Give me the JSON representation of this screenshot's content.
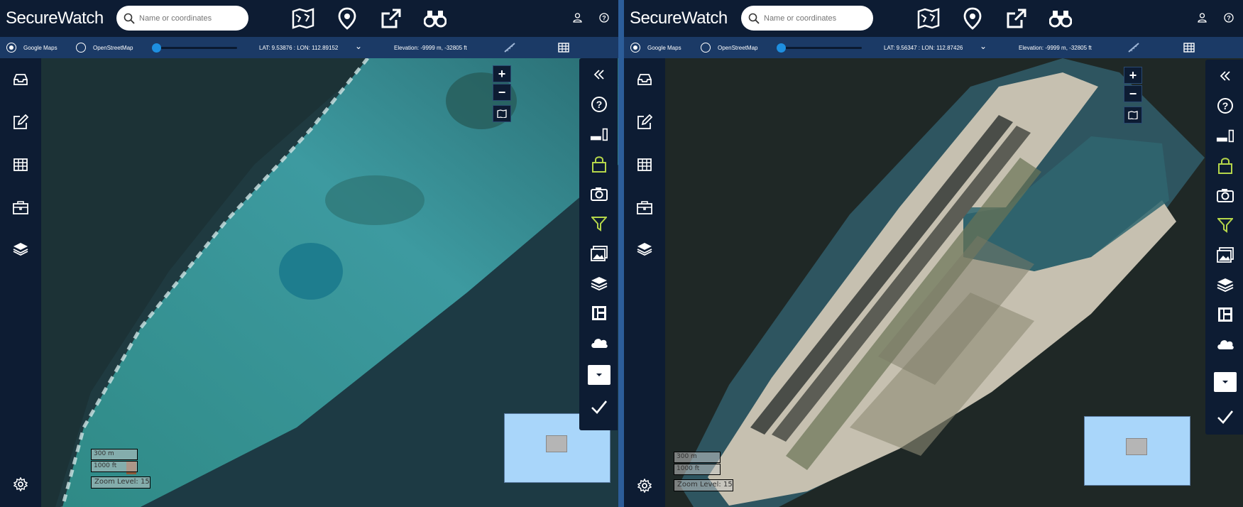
{
  "app": {
    "brand": "SecureWatch",
    "search_placeholder": "Name or coordinates"
  },
  "basemaps": {
    "option1": "Google Maps",
    "option2": "OpenStreetMap",
    "selected": "Google Maps"
  },
  "left_panel": {
    "latlon": "LAT: 9.53876 : LON: 112.89152",
    "elevation": "Elevation: -9999 m, -32805 ft",
    "scale_m": "300 m",
    "scale_ft": "1000 ft",
    "zoom_level": "Zoom Level: 15"
  },
  "right_panel": {
    "latlon": "LAT: 9.56347 : LON: 112.87426",
    "elevation": "Elevation: -9999 m, -32805 ft",
    "scale_m": "300 m",
    "scale_ft": "1000 ft",
    "zoom_level": "Zoom Level: 15"
  },
  "controls": {
    "zoom_in": "+",
    "zoom_out": "−"
  },
  "colors": {
    "bar_dark": "#0d1c33",
    "bar_blue": "#1b3a66",
    "accent_green": "#b5d64a",
    "divider": "#2c5d99"
  },
  "icons": {
    "top": [
      "map-icon",
      "location-pin-icon",
      "external-link-icon",
      "binoculars-icon"
    ],
    "top_right": [
      "user-icon",
      "help-icon"
    ],
    "left_nav": [
      "inbox-icon",
      "edit-icon",
      "grid-icon",
      "briefcase-icon",
      "layers-icon",
      "gear-icon"
    ],
    "rail": [
      "collapse-icon",
      "help-icon",
      "signal-bars-icon",
      "lock-icon",
      "camera-icon",
      "filter-icon",
      "image-icon",
      "layers-icon",
      "id-card-icon",
      "cloud-icon",
      "dropdown-icon",
      "check-icon"
    ]
  }
}
